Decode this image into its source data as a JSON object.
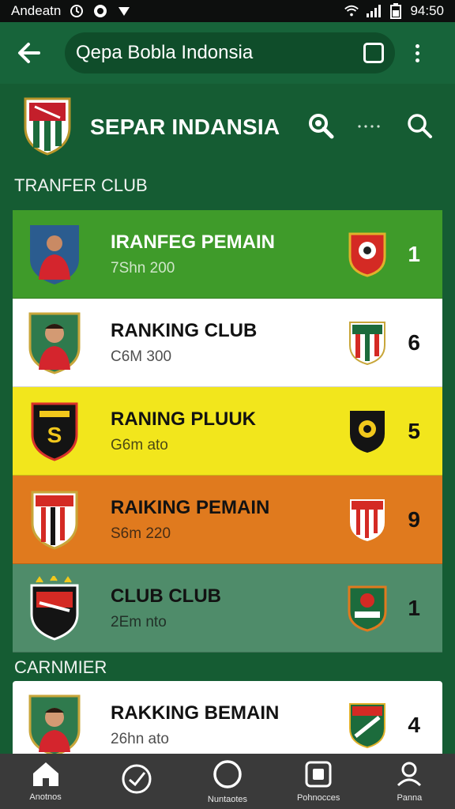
{
  "status_bar": {
    "carrier": "Andeatn",
    "time": "94:50"
  },
  "app_bar": {
    "search_value": "Qepa Bobla Indonsia",
    "back_icon": "arrow-left-icon",
    "square_icon": "square-icon",
    "menu_icon": "more-vertical-icon"
  },
  "header": {
    "title": "SEPAR INDANSIA"
  },
  "sections": {
    "transfer": "TRANFER CLUB",
    "second": "CARNMIER"
  },
  "cards": [
    {
      "name": "IRANFEG PEMAIN",
      "sub": "7Shn 200",
      "rank": "1",
      "bg": "#3f9b2a",
      "text": "#ffffff"
    },
    {
      "name": "RANKING CLUB",
      "sub": "C6M 300",
      "rank": "6",
      "bg": "#ffffff",
      "text": "#121212"
    },
    {
      "name": "RANING PLUUK",
      "sub": "G6m ato",
      "rank": "5",
      "bg": "#f2e61c",
      "text": "#121212"
    },
    {
      "name": "RAIKING PEMAIN",
      "sub": "S6m 220",
      "rank": "9",
      "bg": "#e07a1e",
      "text": "#121212"
    },
    {
      "name": "CLUB CLUB",
      "sub": "2Em nto",
      "rank": "1",
      "bg": "#4f8c6a",
      "text": "#121212"
    },
    {
      "name": "RAKKING BEMAIN",
      "sub": "26hn ato",
      "rank": "4",
      "bg": "#ffffff",
      "text": "#121212"
    }
  ],
  "bottom_nav": [
    {
      "label": "Anotnos",
      "icon": "home-icon"
    },
    {
      "label": "",
      "icon": "clock-check-icon"
    },
    {
      "label": "Nuntaotes",
      "icon": "circle-icon"
    },
    {
      "label": "Pohnocces",
      "icon": "square-badge-icon"
    },
    {
      "label": "Panna",
      "icon": "profile-icon"
    }
  ],
  "colors": {
    "brand_green": "#17643a",
    "background": "#155c33",
    "nav_bg": "#3a3a3a"
  }
}
